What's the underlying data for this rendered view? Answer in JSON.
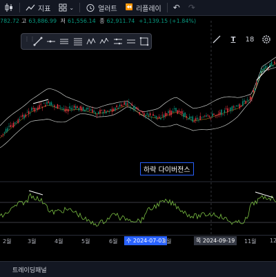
{
  "toolbar": {
    "indicators_label": "지표",
    "alert_label": "얼러트",
    "replay_label": "리플레이"
  },
  "ohlc": {
    "open_value": "782.72",
    "high_key": "고",
    "high_value": "63,886.99",
    "low_key": "저",
    "low_value": "61,556.14",
    "close_key": "종",
    "close_value": "62,911.74",
    "change": "+1,139.15 (+1.84%)"
  },
  "drawing_toolbar": {
    "tools": [
      "trend-line-icon",
      "ray-icon",
      "parallel-channel-icon",
      "fib-icon",
      "pattern-icon",
      "elliott-icon",
      "brush-icon",
      "measure-icon",
      "rectangle-icon"
    ],
    "font_size": "18"
  },
  "annotation": {
    "label": "하락 다이버전스"
  },
  "x_axis": {
    "labels": [
      "2월",
      "3월",
      "4월",
      "5월",
      "6월",
      "8월",
      "9월",
      "11월",
      "12"
    ],
    "crosshair_left": "수 2024-07-03",
    "crosshair_right": "목 2024-09-19"
  },
  "bottom_panel": {
    "label": "트레이딩패널"
  },
  "colors": {
    "up": "#089981",
    "down": "#f23645",
    "band": "#c9ccc9",
    "rsi": "#7bc043",
    "accent": "#2962ff"
  }
}
